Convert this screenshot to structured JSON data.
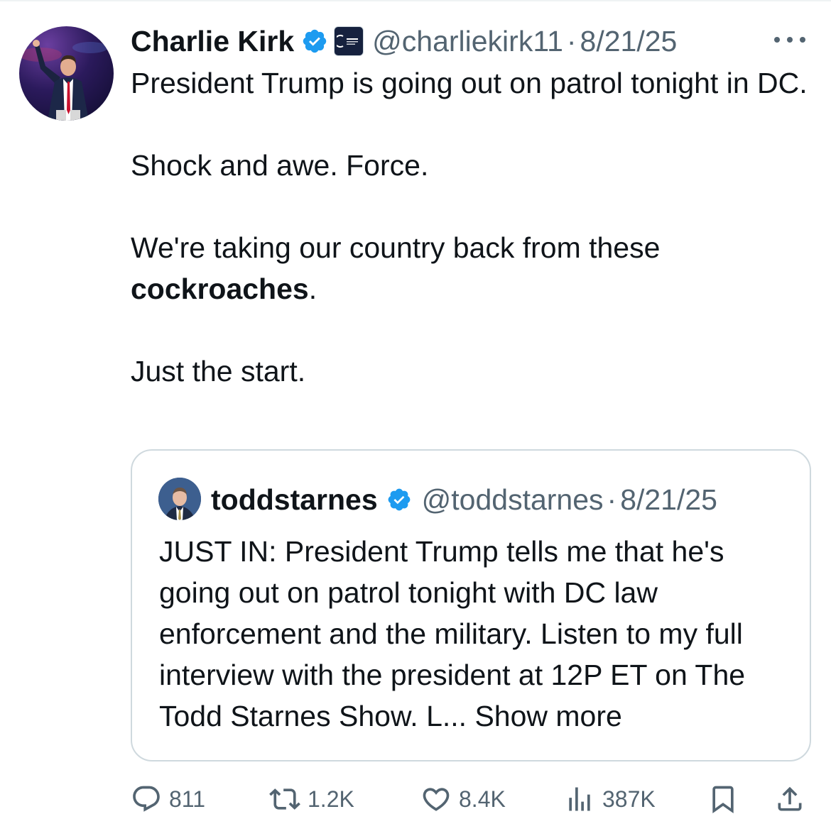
{
  "colors": {
    "text": "#0f1419",
    "secondary": "#536471",
    "verified": "#1d9bf0",
    "border": "#cfd9de"
  },
  "tweet": {
    "author_name": "Charlie Kirk",
    "handle": "@charliekirk11",
    "separator": "·",
    "date": "8/21/25",
    "affiliation_badge": "TURNING POINT USA",
    "lines": {
      "p1": "President Trump is going out on patrol tonight in DC.",
      "p2": "Shock and awe. Force.",
      "p3_start": "We're taking our country back from these ",
      "p3_bold": "cockroaches",
      "p3_end": ".",
      "p4": "Just the start."
    }
  },
  "quote": {
    "author_name": "toddstarnes",
    "handle": "@toddstarnes",
    "separator": "·",
    "date": "8/21/25",
    "text": "JUST IN: President Trump tells me that he's going out on patrol tonight with DC law enforcement and the military. Listen to my full interview with the president at 12P ET on The Todd Starnes Show. L...",
    "show_more": "Show more"
  },
  "actions": {
    "replies": "811",
    "reposts": "1.2K",
    "likes": "8.4K",
    "views": "387K"
  },
  "icons": [
    "verified-badge-icon",
    "more-icon",
    "reply-icon",
    "repost-icon",
    "like-icon",
    "views-icon",
    "bookmark-icon",
    "share-icon"
  ]
}
